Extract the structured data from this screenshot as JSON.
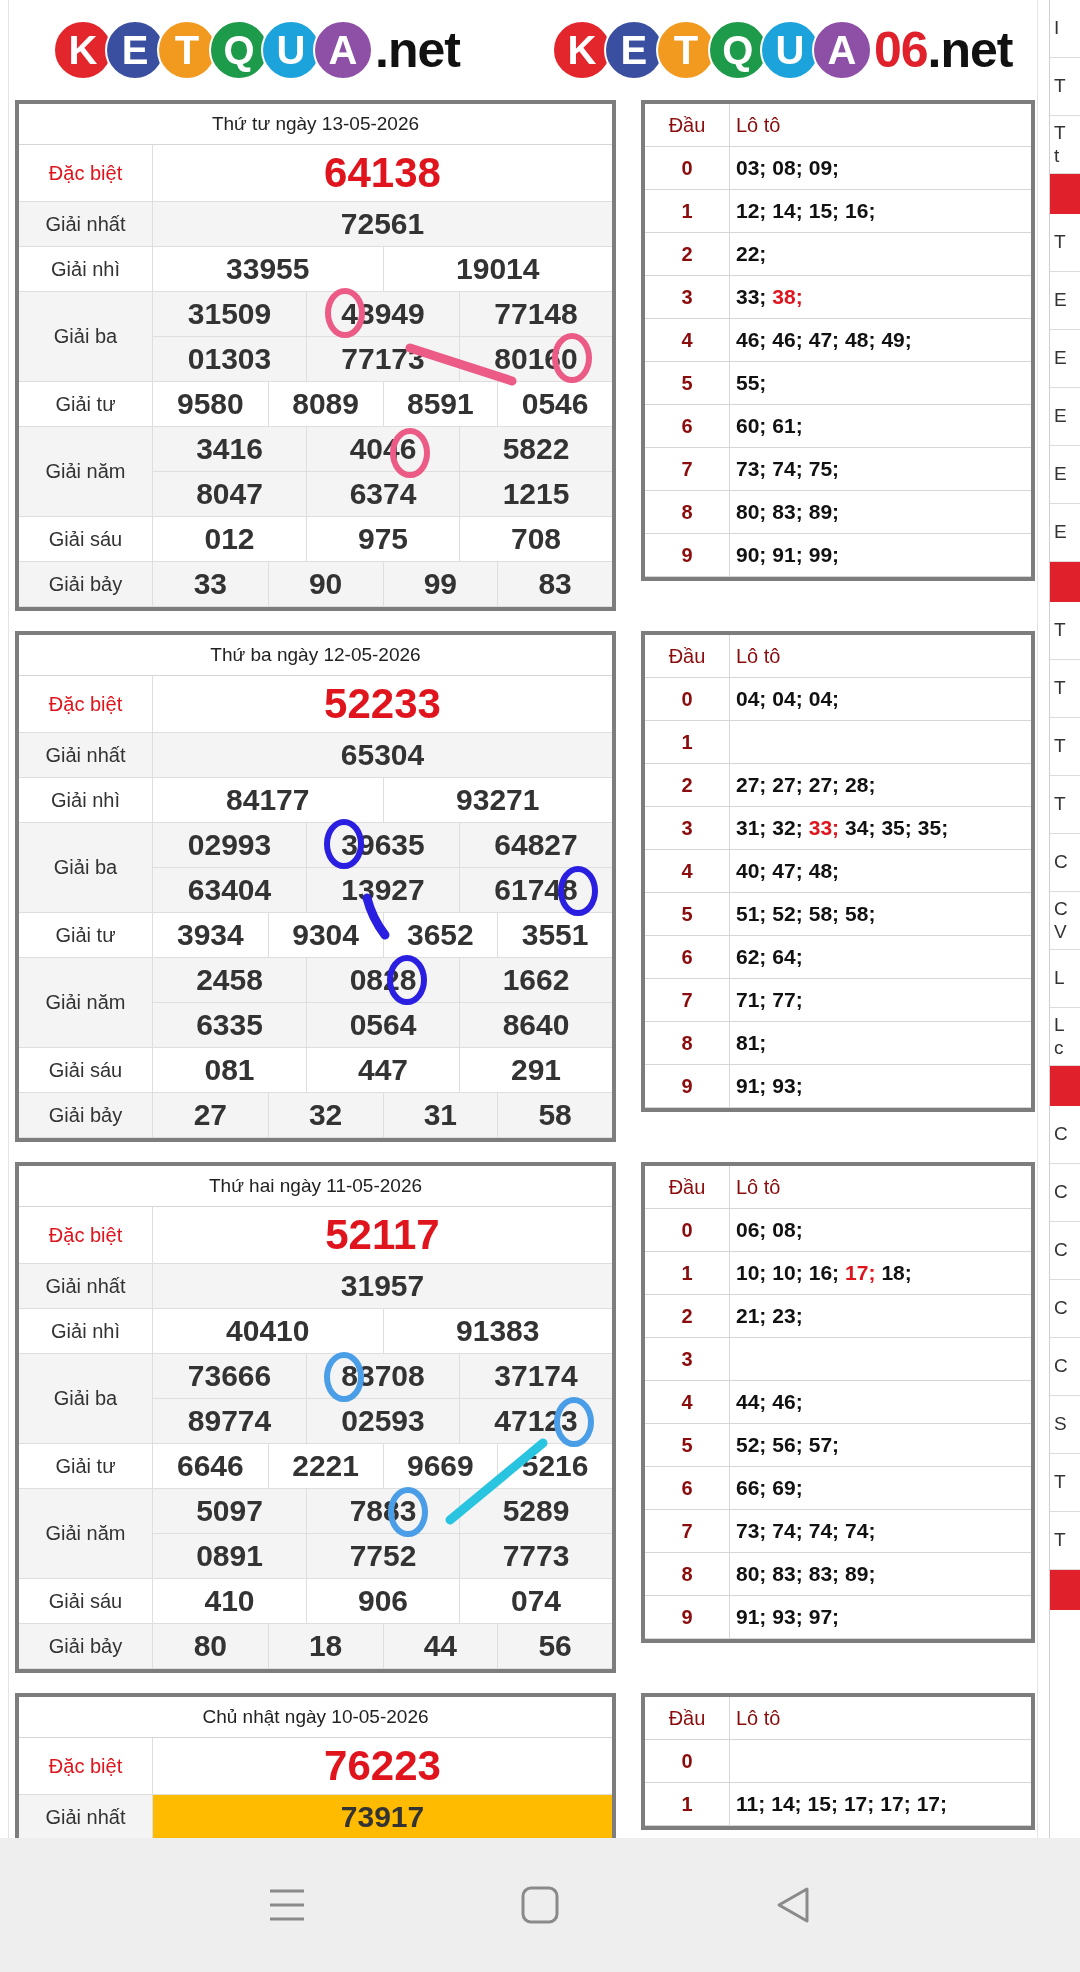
{
  "logos": [
    {
      "balls": [
        {
          "letter": "K",
          "color": "#e3262c"
        },
        {
          "letter": "E",
          "color": "#3b4fa1"
        },
        {
          "letter": "T",
          "color": "#f29a1f"
        },
        {
          "letter": "Q",
          "color": "#1e9a4b"
        },
        {
          "letter": "U",
          "color": "#1ca3dc"
        },
        {
          "letter": "A",
          "color": "#8e4fa6"
        }
      ],
      "parts": [
        {
          "text": ".net",
          "color": "#111111"
        }
      ]
    },
    {
      "balls": [
        {
          "letter": "K",
          "color": "#e3262c"
        },
        {
          "letter": "E",
          "color": "#3b4fa1"
        },
        {
          "letter": "T",
          "color": "#f29a1f"
        },
        {
          "letter": "Q",
          "color": "#1e9a4b"
        },
        {
          "letter": "U",
          "color": "#1ca3dc"
        },
        {
          "letter": "A",
          "color": "#8e4fa6"
        }
      ],
      "parts": [
        {
          "text": "06",
          "color": "#e0202a"
        },
        {
          "text": ".net",
          "color": "#111111"
        }
      ]
    }
  ],
  "days": [
    {
      "title": "Thứ tư ngày 13-05-2026",
      "prizes": [
        {
          "label": "Đặc biệt",
          "kind": "special",
          "highlighted": false,
          "lines": [
            [
              "64138"
            ]
          ]
        },
        {
          "label": "Giải nhất",
          "kind": "normal",
          "highlighted": false,
          "lines": [
            [
              "72561"
            ]
          ]
        },
        {
          "label": "Giải nhì",
          "kind": "normal",
          "highlighted": false,
          "lines": [
            [
              "33955",
              "19014"
            ]
          ]
        },
        {
          "label": "Giải ba",
          "kind": "normal",
          "highlighted": false,
          "lines": [
            [
              "31509",
              "43949",
              "77148"
            ],
            [
              "01303",
              "77173",
              "80160"
            ]
          ]
        },
        {
          "label": "Giải tư",
          "kind": "normal",
          "highlighted": false,
          "lines": [
            [
              "9580",
              "8089",
              "8591",
              "0546"
            ]
          ]
        },
        {
          "label": "Giải năm",
          "kind": "normal",
          "highlighted": false,
          "lines": [
            [
              "3416",
              "4046",
              "5822"
            ],
            [
              "8047",
              "6374",
              "1215"
            ]
          ]
        },
        {
          "label": "Giải sáu",
          "kind": "normal",
          "highlighted": false,
          "lines": [
            [
              "012",
              "975",
              "708"
            ]
          ]
        },
        {
          "label": "Giải bảy",
          "kind": "normal",
          "highlighted": false,
          "lines": [
            [
              "33",
              "90",
              "99",
              "83"
            ]
          ]
        }
      ],
      "loto": {
        "head_label": "Đầu",
        "body_label": "Lô tô",
        "rows": [
          {
            "head": "0",
            "numbers": [
              {
                "text": "03;",
                "red": false
              },
              {
                "text": "08;",
                "red": false
              },
              {
                "text": "09;",
                "red": false
              }
            ]
          },
          {
            "head": "1",
            "numbers": [
              {
                "text": "12;",
                "red": false
              },
              {
                "text": "14;",
                "red": false
              },
              {
                "text": "15;",
                "red": false
              },
              {
                "text": "16;",
                "red": false
              }
            ]
          },
          {
            "head": "2",
            "numbers": [
              {
                "text": "22;",
                "red": false
              }
            ]
          },
          {
            "head": "3",
            "numbers": [
              {
                "text": "33;",
                "red": false
              },
              {
                "text": "38;",
                "red": true
              }
            ]
          },
          {
            "head": "4",
            "numbers": [
              {
                "text": "46;",
                "red": false
              },
              {
                "text": "46;",
                "red": false
              },
              {
                "text": "47;",
                "red": false
              },
              {
                "text": "48;",
                "red": false
              },
              {
                "text": "49;",
                "red": false
              }
            ]
          },
          {
            "head": "5",
            "numbers": [
              {
                "text": "55;",
                "red": false
              }
            ]
          },
          {
            "head": "6",
            "numbers": [
              {
                "text": "60;",
                "red": false
              },
              {
                "text": "61;",
                "red": false
              }
            ]
          },
          {
            "head": "7",
            "numbers": [
              {
                "text": "73;",
                "red": false
              },
              {
                "text": "74;",
                "red": false
              },
              {
                "text": "75;",
                "red": false
              }
            ]
          },
          {
            "head": "8",
            "numbers": [
              {
                "text": "80;",
                "red": false
              },
              {
                "text": "83;",
                "red": false
              },
              {
                "text": "89;",
                "red": false
              }
            ]
          },
          {
            "head": "9",
            "numbers": [
              {
                "text": "90;",
                "red": false
              },
              {
                "text": "91;",
                "red": false
              },
              {
                "text": "99;",
                "red": false
              }
            ]
          }
        ]
      }
    },
    {
      "title": "Thứ ba ngày 12-05-2026",
      "prizes": [
        {
          "label": "Đặc biệt",
          "kind": "special",
          "highlighted": false,
          "lines": [
            [
              "52233"
            ]
          ]
        },
        {
          "label": "Giải nhất",
          "kind": "normal",
          "highlighted": false,
          "lines": [
            [
              "65304"
            ]
          ]
        },
        {
          "label": "Giải nhì",
          "kind": "normal",
          "highlighted": false,
          "lines": [
            [
              "84177",
              "93271"
            ]
          ]
        },
        {
          "label": "Giải ba",
          "kind": "normal",
          "highlighted": false,
          "lines": [
            [
              "02993",
              "39635",
              "64827"
            ],
            [
              "63404",
              "13927",
              "61748"
            ]
          ]
        },
        {
          "label": "Giải tư",
          "kind": "normal",
          "highlighted": false,
          "lines": [
            [
              "3934",
              "9304",
              "3652",
              "3551"
            ]
          ]
        },
        {
          "label": "Giải năm",
          "kind": "normal",
          "highlighted": false,
          "lines": [
            [
              "2458",
              "0828",
              "1662"
            ],
            [
              "6335",
              "0564",
              "8640"
            ]
          ]
        },
        {
          "label": "Giải sáu",
          "kind": "normal",
          "highlighted": false,
          "lines": [
            [
              "081",
              "447",
              "291"
            ]
          ]
        },
        {
          "label": "Giải bảy",
          "kind": "normal",
          "highlighted": false,
          "lines": [
            [
              "27",
              "32",
              "31",
              "58"
            ]
          ]
        }
      ],
      "loto": {
        "head_label": "Đầu",
        "body_label": "Lô tô",
        "rows": [
          {
            "head": "0",
            "numbers": [
              {
                "text": "04;",
                "red": false
              },
              {
                "text": "04;",
                "red": false
              },
              {
                "text": "04;",
                "red": false
              }
            ]
          },
          {
            "head": "1",
            "numbers": []
          },
          {
            "head": "2",
            "numbers": [
              {
                "text": "27;",
                "red": false
              },
              {
                "text": "27;",
                "red": false
              },
              {
                "text": "27;",
                "red": false
              },
              {
                "text": "28;",
                "red": false
              }
            ]
          },
          {
            "head": "3",
            "numbers": [
              {
                "text": "31;",
                "red": false
              },
              {
                "text": "32;",
                "red": false
              },
              {
                "text": "33;",
                "red": true
              },
              {
                "text": "34;",
                "red": false
              },
              {
                "text": "35;",
                "red": false
              },
              {
                "text": "35;",
                "red": false
              }
            ]
          },
          {
            "head": "4",
            "numbers": [
              {
                "text": "40;",
                "red": false
              },
              {
                "text": "47;",
                "red": false
              },
              {
                "text": "48;",
                "red": false
              }
            ]
          },
          {
            "head": "5",
            "numbers": [
              {
                "text": "51;",
                "red": false
              },
              {
                "text": "52;",
                "red": false
              },
              {
                "text": "58;",
                "red": false
              },
              {
                "text": "58;",
                "red": false
              }
            ]
          },
          {
            "head": "6",
            "numbers": [
              {
                "text": "62;",
                "red": false
              },
              {
                "text": "64;",
                "red": false
              }
            ]
          },
          {
            "head": "7",
            "numbers": [
              {
                "text": "71;",
                "red": false
              },
              {
                "text": "77;",
                "red": false
              }
            ]
          },
          {
            "head": "8",
            "numbers": [
              {
                "text": "81;",
                "red": false
              }
            ]
          },
          {
            "head": "9",
            "numbers": [
              {
                "text": "91;",
                "red": false
              },
              {
                "text": "93;",
                "red": false
              }
            ]
          }
        ]
      }
    },
    {
      "title": "Thứ hai ngày 11-05-2026",
      "prizes": [
        {
          "label": "Đặc biệt",
          "kind": "special",
          "highlighted": false,
          "lines": [
            [
              "52117"
            ]
          ]
        },
        {
          "label": "Giải nhất",
          "kind": "normal",
          "highlighted": false,
          "lines": [
            [
              "31957"
            ]
          ]
        },
        {
          "label": "Giải nhì",
          "kind": "normal",
          "highlighted": false,
          "lines": [
            [
              "40410",
              "91383"
            ]
          ]
        },
        {
          "label": "Giải ba",
          "kind": "normal",
          "highlighted": false,
          "lines": [
            [
              "73666",
              "83708",
              "37174"
            ],
            [
              "89774",
              "02593",
              "47123"
            ]
          ]
        },
        {
          "label": "Giải tư",
          "kind": "normal",
          "highlighted": false,
          "lines": [
            [
              "6646",
              "2221",
              "9669",
              "5216"
            ]
          ]
        },
        {
          "label": "Giải năm",
          "kind": "normal",
          "highlighted": false,
          "lines": [
            [
              "5097",
              "7883",
              "5289"
            ],
            [
              "0891",
              "7752",
              "7773"
            ]
          ]
        },
        {
          "label": "Giải sáu",
          "kind": "normal",
          "highlighted": false,
          "lines": [
            [
              "410",
              "906",
              "074"
            ]
          ]
        },
        {
          "label": "Giải bảy",
          "kind": "normal",
          "highlighted": false,
          "lines": [
            [
              "80",
              "18",
              "44",
              "56"
            ]
          ]
        }
      ],
      "loto": {
        "head_label": "Đầu",
        "body_label": "Lô tô",
        "rows": [
          {
            "head": "0",
            "numbers": [
              {
                "text": "06;",
                "red": false
              },
              {
                "text": "08;",
                "red": false
              }
            ]
          },
          {
            "head": "1",
            "numbers": [
              {
                "text": "10;",
                "red": false
              },
              {
                "text": "10;",
                "red": false
              },
              {
                "text": "16;",
                "red": false
              },
              {
                "text": "17;",
                "red": true
              },
              {
                "text": "18;",
                "red": false
              }
            ]
          },
          {
            "head": "2",
            "numbers": [
              {
                "text": "21;",
                "red": false
              },
              {
                "text": "23;",
                "red": false
              }
            ]
          },
          {
            "head": "3",
            "numbers": []
          },
          {
            "head": "4",
            "numbers": [
              {
                "text": "44;",
                "red": false
              },
              {
                "text": "46;",
                "red": false
              }
            ]
          },
          {
            "head": "5",
            "numbers": [
              {
                "text": "52;",
                "red": false
              },
              {
                "text": "56;",
                "red": false
              },
              {
                "text": "57;",
                "red": false
              }
            ]
          },
          {
            "head": "6",
            "numbers": [
              {
                "text": "66;",
                "red": false
              },
              {
                "text": "69;",
                "red": false
              }
            ]
          },
          {
            "head": "7",
            "numbers": [
              {
                "text": "73;",
                "red": false
              },
              {
                "text": "74;",
                "red": false
              },
              {
                "text": "74;",
                "red": false
              },
              {
                "text": "74;",
                "red": false
              }
            ]
          },
          {
            "head": "8",
            "numbers": [
              {
                "text": "80;",
                "red": false
              },
              {
                "text": "83;",
                "red": false
              },
              {
                "text": "83;",
                "red": false
              },
              {
                "text": "89;",
                "red": false
              }
            ]
          },
          {
            "head": "9",
            "numbers": [
              {
                "text": "91;",
                "red": false
              },
              {
                "text": "93;",
                "red": false
              },
              {
                "text": "97;",
                "red": false
              }
            ]
          }
        ]
      }
    },
    {
      "title": "Chủ nhật ngày 10-05-2026",
      "prizes": [
        {
          "label": "Đặc biệt",
          "kind": "special",
          "highlighted": false,
          "lines": [
            [
              "76223"
            ]
          ]
        },
        {
          "label": "Giải nhất",
          "kind": "normal",
          "highlighted": true,
          "lines": [
            [
              "73917"
            ]
          ]
        }
      ],
      "loto": {
        "head_label": "Đầu",
        "body_label": "Lô tô",
        "rows": [
          {
            "head": "0",
            "numbers": []
          },
          {
            "head": "1",
            "numbers": [
              {
                "text": "11;",
                "red": false
              },
              {
                "text": "14;",
                "red": false
              },
              {
                "text": "15;",
                "red": false
              },
              {
                "text": "17;",
                "red": false
              },
              {
                "text": "17;",
                "red": false
              },
              {
                "text": "17;",
                "red": false
              }
            ]
          }
        ]
      }
    }
  ],
  "side_panel": [
    {
      "kind": "row",
      "text": "I"
    },
    {
      "kind": "row",
      "text": "T"
    },
    {
      "kind": "row",
      "text": "T\nt"
    },
    {
      "kind": "header"
    },
    {
      "kind": "row",
      "text": "T"
    },
    {
      "kind": "row",
      "text": "E"
    },
    {
      "kind": "row",
      "text": "E"
    },
    {
      "kind": "row",
      "text": "E"
    },
    {
      "kind": "row",
      "text": "E"
    },
    {
      "kind": "row",
      "text": "E"
    },
    {
      "kind": "header"
    },
    {
      "kind": "row",
      "text": "T"
    },
    {
      "kind": "row",
      "text": "T"
    },
    {
      "kind": "row",
      "text": "T"
    },
    {
      "kind": "row",
      "text": "T"
    },
    {
      "kind": "row",
      "text": "C"
    },
    {
      "kind": "row",
      "text": "C\nV"
    },
    {
      "kind": "row",
      "text": "L"
    },
    {
      "kind": "row",
      "text": "L\nc"
    },
    {
      "kind": "header"
    },
    {
      "kind": "row",
      "text": "C"
    },
    {
      "kind": "row",
      "text": "C"
    },
    {
      "kind": "row",
      "text": "C"
    },
    {
      "kind": "row",
      "text": "C"
    },
    {
      "kind": "row",
      "text": "C"
    },
    {
      "kind": "row",
      "text": "S"
    },
    {
      "kind": "row",
      "text": "T"
    },
    {
      "kind": "row",
      "text": "T"
    },
    {
      "kind": "header"
    }
  ]
}
